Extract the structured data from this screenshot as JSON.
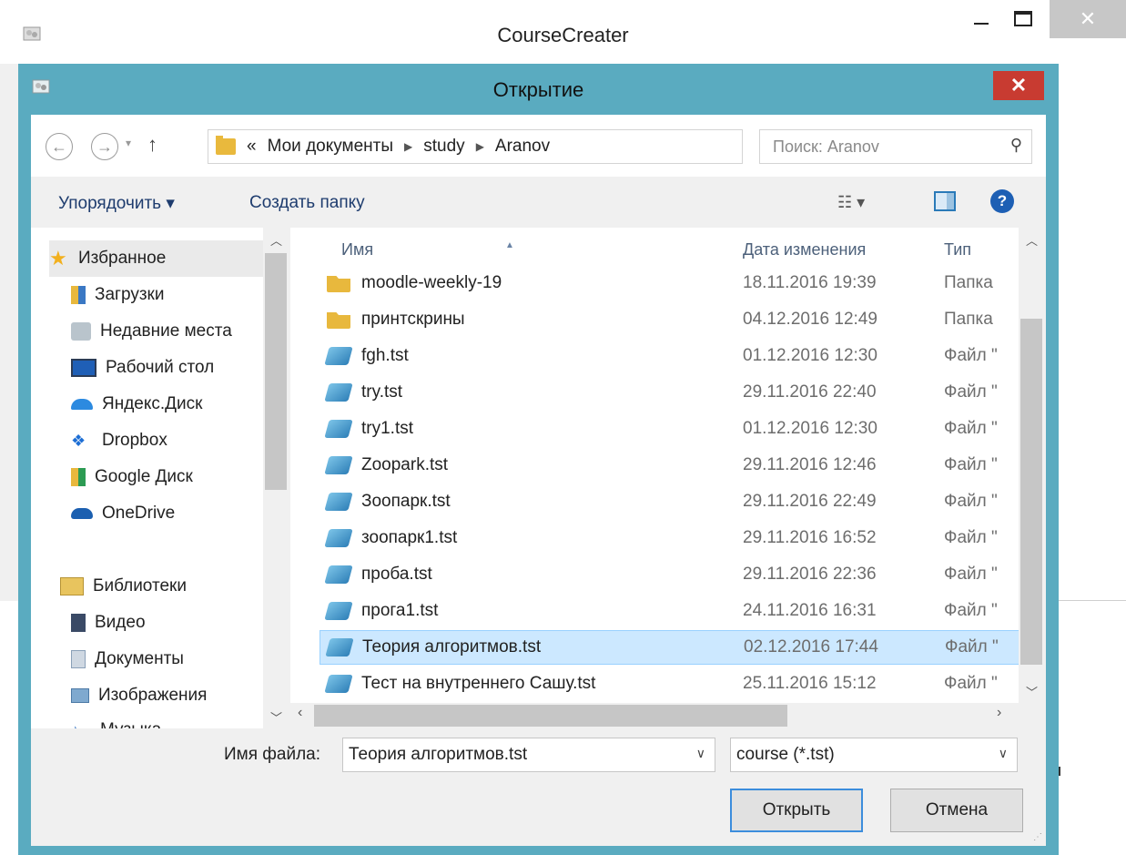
{
  "app": {
    "title": "CourseCreater",
    "minimize_icon": "minimize-icon",
    "maximize_icon": "maximize-icon",
    "close_icon": "close-icon"
  },
  "dialog": {
    "title": "Открытие",
    "close_glyph": "✕",
    "title_bar_color": "#5aabc0"
  },
  "navigation": {
    "back_glyph": "←",
    "forward_glyph": "→",
    "up_glyph": "↑",
    "address": {
      "overflow": "«",
      "parts": [
        "Мои документы",
        "study",
        "Aranov"
      ]
    },
    "search_placeholder": "Поиск: Aranov"
  },
  "toolbar": {
    "organize_label": "Упорядочить ▾",
    "new_folder_label": "Создать папку",
    "help_glyph": "?"
  },
  "nav_pane": {
    "items": [
      {
        "label": "Избранное",
        "icon": "star-icon"
      },
      {
        "label": "Загрузки",
        "icon": "downloads-icon"
      },
      {
        "label": "Недавние места",
        "icon": "recent-places-icon"
      },
      {
        "label": "Рабочий стол",
        "icon": "desktop-icon"
      },
      {
        "label": "Яндекс.Диск",
        "icon": "yandex-disk-icon"
      },
      {
        "label": "Dropbox",
        "icon": "dropbox-icon"
      },
      {
        "label": "Google Диск",
        "icon": "google-drive-icon"
      },
      {
        "label": "OneDrive",
        "icon": "onedrive-icon"
      },
      {
        "label": "Библиотеки",
        "icon": "libraries-icon"
      },
      {
        "label": "Видео",
        "icon": "video-icon"
      },
      {
        "label": "Документы",
        "icon": "documents-icon"
      },
      {
        "label": "Изображения",
        "icon": "pictures-icon"
      },
      {
        "label": "Музыка",
        "icon": "music-icon"
      }
    ]
  },
  "file_list": {
    "columns": [
      "Имя",
      "Дата изменения",
      "Тип"
    ],
    "rows": [
      {
        "name": "moodle-weekly-19",
        "date": "18.11.2016 19:39",
        "type": "Папка",
        "kind": "folder"
      },
      {
        "name": "принтскрины",
        "date": "04.12.2016 12:49",
        "type": "Папка",
        "kind": "folder"
      },
      {
        "name": "fgh.tst",
        "date": "01.12.2016 12:30",
        "type": "Файл \"",
        "kind": "file"
      },
      {
        "name": "try.tst",
        "date": "29.11.2016 22:40",
        "type": "Файл \"",
        "kind": "file"
      },
      {
        "name": "try1.tst",
        "date": "01.12.2016 12:30",
        "type": "Файл \"",
        "kind": "file"
      },
      {
        "name": "Zoopark.tst",
        "date": "29.11.2016 12:46",
        "type": "Файл \"",
        "kind": "file"
      },
      {
        "name": "Зоопарк.tst",
        "date": "29.11.2016 22:49",
        "type": "Файл \"",
        "kind": "file"
      },
      {
        "name": "зоопарк1.tst",
        "date": "29.11.2016 16:52",
        "type": "Файл \"",
        "kind": "file"
      },
      {
        "name": "проба.tst",
        "date": "29.11.2016 22:36",
        "type": "Файл \"",
        "kind": "file"
      },
      {
        "name": "прога1.tst",
        "date": "24.11.2016 16:31",
        "type": "Файл \"",
        "kind": "file"
      },
      {
        "name": "Теория алгоритмов.tst",
        "date": "02.12.2016 17:44",
        "type": "Файл \"",
        "kind": "file",
        "selected": true
      },
      {
        "name": "Тест на внутреннего Сашу.tst",
        "date": "25.11.2016 15:12",
        "type": "Файл \"",
        "kind": "file"
      }
    ]
  },
  "bottom": {
    "file_name_label": "Имя файла:",
    "file_name_value": "Теория алгоритмов.tst",
    "filter_value": "course (*.tst)",
    "open_label": "Открыть",
    "cancel_label": "Отмена"
  }
}
